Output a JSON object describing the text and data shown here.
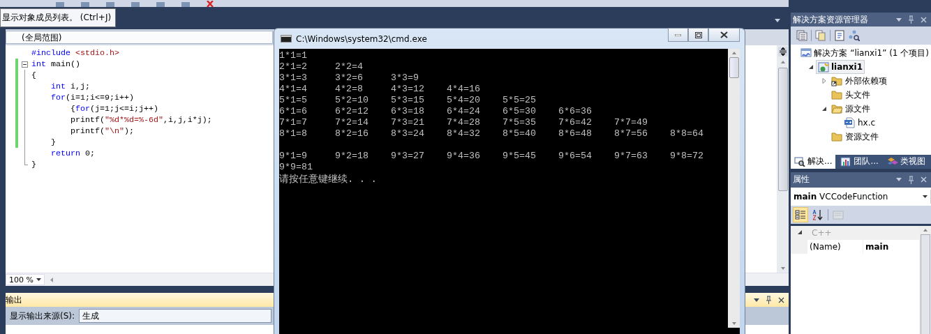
{
  "toolbar": {
    "tooltip": "显示对象成员列表。 (Ctrl+J)"
  },
  "editor": {
    "scope": "(全局范围)",
    "zoom": "100 %",
    "lines": [
      {
        "fold": false,
        "changed": false,
        "tokens": [
          {
            "text": "#include",
            "kind": "keyword"
          },
          {
            "text": " <stdio.h>",
            "kind": "string"
          }
        ]
      },
      {
        "fold": true,
        "changed": true,
        "tokens": [
          {
            "text": "int",
            "kind": "keyword"
          },
          {
            "text": " main()",
            "kind": "plain"
          }
        ]
      },
      {
        "fold": false,
        "changed": true,
        "tokens": [
          {
            "text": "{",
            "kind": "plain"
          }
        ]
      },
      {
        "fold": false,
        "changed": true,
        "tokens": [
          {
            "text": "    int",
            "kind": "keyword"
          },
          {
            "text": " i,j;",
            "kind": "plain"
          }
        ]
      },
      {
        "fold": false,
        "changed": true,
        "tokens": [
          {
            "text": "    for",
            "kind": "keyword"
          },
          {
            "text": "(i=1;i<=9;i++)",
            "kind": "plain"
          }
        ]
      },
      {
        "fold": false,
        "changed": true,
        "tokens": [
          {
            "text": "        {",
            "kind": "plain"
          },
          {
            "text": "for",
            "kind": "keyword"
          },
          {
            "text": "(j=1;j<=i;j++)",
            "kind": "plain"
          }
        ]
      },
      {
        "fold": false,
        "changed": true,
        "tokens": [
          {
            "text": "        printf(",
            "kind": "plain"
          },
          {
            "text": "\"%d*%d=%-6d\"",
            "kind": "string"
          },
          {
            "text": ",i,j,i*j);",
            "kind": "plain"
          }
        ]
      },
      {
        "fold": false,
        "changed": true,
        "tokens": [
          {
            "text": "        printf(",
            "kind": "plain"
          },
          {
            "text": "\"\\n\"",
            "kind": "string"
          },
          {
            "text": ");",
            "kind": "plain"
          }
        ]
      },
      {
        "fold": false,
        "changed": true,
        "tokens": [
          {
            "text": "    }",
            "kind": "plain"
          }
        ]
      },
      {
        "fold": false,
        "changed": false,
        "tokens": [
          {
            "text": "    return",
            "kind": "keyword"
          },
          {
            "text": " 0;",
            "kind": "plain"
          }
        ]
      },
      {
        "fold": false,
        "changed": false,
        "tokens": [
          {
            "text": "}",
            "kind": "plain"
          }
        ]
      }
    ]
  },
  "output": {
    "title": "输出",
    "source_label": "显示输出来源(S):",
    "source": "生成"
  },
  "console": {
    "title": "C:\\Windows\\system32\\cmd.exe",
    "lines": [
      {
        "cells": [
          "1*1=1"
        ]
      },
      {
        "cells": [
          "2*1=2",
          "2*2=4"
        ]
      },
      {
        "cells": [
          "3*1=3",
          "3*2=6",
          "3*3=9"
        ]
      },
      {
        "cells": [
          "4*1=4",
          "4*2=8",
          "4*3=12",
          "4*4=16"
        ]
      },
      {
        "cells": [
          "5*1=5",
          "5*2=10",
          "5*3=15",
          "5*4=20",
          "5*5=25"
        ]
      },
      {
        "cells": [
          "6*1=6",
          "6*2=12",
          "6*3=18",
          "6*4=24",
          "6*5=30",
          "6*6=36"
        ]
      },
      {
        "cells": [
          "7*1=7",
          "7*2=14",
          "7*3=21",
          "7*4=28",
          "7*5=35",
          "7*6=42",
          "7*7=49"
        ]
      },
      {
        "cells": [
          "8*1=8",
          "8*2=16",
          "8*3=24",
          "8*4=32",
          "8*5=40",
          "8*6=48",
          "8*7=56",
          "8*8=64"
        ]
      },
      {
        "cells": [
          "9*1=9",
          "9*2=18",
          "9*3=27",
          "9*4=36",
          "9*5=45",
          "9*6=54",
          "9*7=63",
          "9*8=72",
          "9*9=81"
        ]
      }
    ],
    "prompt": "请按任意键继续. . ."
  },
  "solution_explorer": {
    "title": "解决方案资源管理器",
    "tree": [
      {
        "label": "解决方案 “lianxi1” (1 个项目)",
        "kind": "solution",
        "selected": false,
        "expander": false,
        "expanded": true,
        "children": [
          {
            "label": "lianxi1",
            "kind": "project",
            "selected": true,
            "expander": true,
            "expanded": true,
            "children": [
              {
                "label": "外部依赖项",
                "kind": "folder-link",
                "selected": false,
                "expander": true,
                "expanded": false
              },
              {
                "label": "头文件",
                "kind": "folder",
                "selected": false,
                "expander": false,
                "expanded": false
              },
              {
                "label": "源文件",
                "kind": "folder",
                "selected": false,
                "expander": true,
                "expanded": true,
                "children": [
                  {
                    "label": "hx.c",
                    "kind": "file",
                    "selected": false,
                    "expander": false
                  }
                ]
              },
              {
                "label": "资源文件",
                "kind": "folder",
                "selected": false,
                "expander": false,
                "expanded": false
              }
            ]
          }
        ]
      }
    ],
    "tabs": [
      {
        "label": "解决...",
        "kind": "solution",
        "selected": true
      },
      {
        "label": "团队...",
        "kind": "team",
        "selected": false
      },
      {
        "label": "类视图",
        "kind": "class",
        "selected": false
      }
    ]
  },
  "properties": {
    "title": "属性",
    "object_name": "main",
    "object_type": "VCCodeFunction",
    "tools": [
      {
        "kind": "categorized",
        "selected": true,
        "disabled": false
      },
      {
        "kind": "alphabetical",
        "selected": false,
        "disabled": false
      },
      {
        "kind": "pages",
        "selected": false,
        "disabled": true
      }
    ],
    "category": {
      "label": "C++",
      "expanded": true
    },
    "rows": [
      {
        "name": "(Name)",
        "value": "main"
      }
    ]
  }
}
